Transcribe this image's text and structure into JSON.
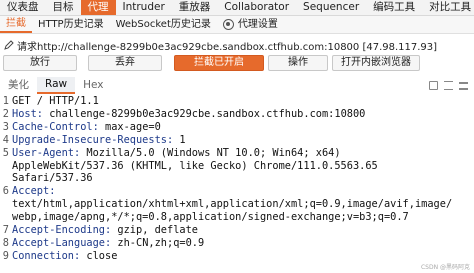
{
  "menu": {
    "items": [
      "仪表盘",
      "目标",
      "代理",
      "Intruder",
      "重放器",
      "Collaborator",
      "Sequencer",
      "编码工具",
      "对比工具"
    ],
    "active_index": 2
  },
  "subtabs": {
    "items": [
      "拦截",
      "HTTP历史记录",
      "WebSocket历史记录"
    ],
    "settings_label": "代理设置",
    "settings_icon": "gear-icon",
    "active_index": 0
  },
  "request_info": {
    "text": "请求http://challenge-8299b0e3ac929cbe.sandbox.ctfhub.com:10800  [47.98.117.93]",
    "icon": "pencil-icon"
  },
  "buttons": {
    "forward": "放行",
    "drop": "丢弃",
    "intercept": "拦截已开启",
    "action": "操作",
    "open_browser": "打开内嵌浏览器"
  },
  "view_tabs": {
    "items": [
      "美化",
      "Raw",
      "Hex"
    ],
    "active_index": 1
  },
  "editor_lines": [
    {
      "num": "1",
      "key": "",
      "text": "GET / HTTP/1.1"
    },
    {
      "num": "2",
      "key": "Host:",
      "text": " challenge-8299b0e3ac929cbe.sandbox.ctfhub.com:10800"
    },
    {
      "num": "3",
      "key": "Cache-Control:",
      "text": " max-age=0"
    },
    {
      "num": "4",
      "key": "Upgrade-Insecure-Requests:",
      "text": " 1"
    },
    {
      "num": "5",
      "key": "User-Agent:",
      "text": " Mozilla/5.0 (Windows NT 10.0; Win64; x64)"
    },
    {
      "num": "",
      "key": "",
      "text": "AppleWebKit/537.36 (KHTML, like Gecko) Chrome/111.0.5563.65"
    },
    {
      "num": "",
      "key": "",
      "text": "Safari/537.36"
    },
    {
      "num": "6",
      "key": "Accept:",
      "text": ""
    },
    {
      "num": "",
      "key": "",
      "text": "text/html,application/xhtml+xml,application/xml;q=0.9,image/avif,image/"
    },
    {
      "num": "",
      "key": "",
      "text": "webp,image/apng,*/*;q=0.8,application/signed-exchange;v=b3;q=0.7"
    },
    {
      "num": "7",
      "key": "Accept-Encoding:",
      "text": " gzip, deflate"
    },
    {
      "num": "8",
      "key": "Accept-Language:",
      "text": " zh-CN,zh;q=0.9"
    },
    {
      "num": "9",
      "key": "Connection:",
      "text": " close"
    }
  ],
  "watermark": "CSDN @黑码阿克",
  "colors": {
    "accent": "#e66a2c",
    "header_key": "#1e3a8a"
  }
}
